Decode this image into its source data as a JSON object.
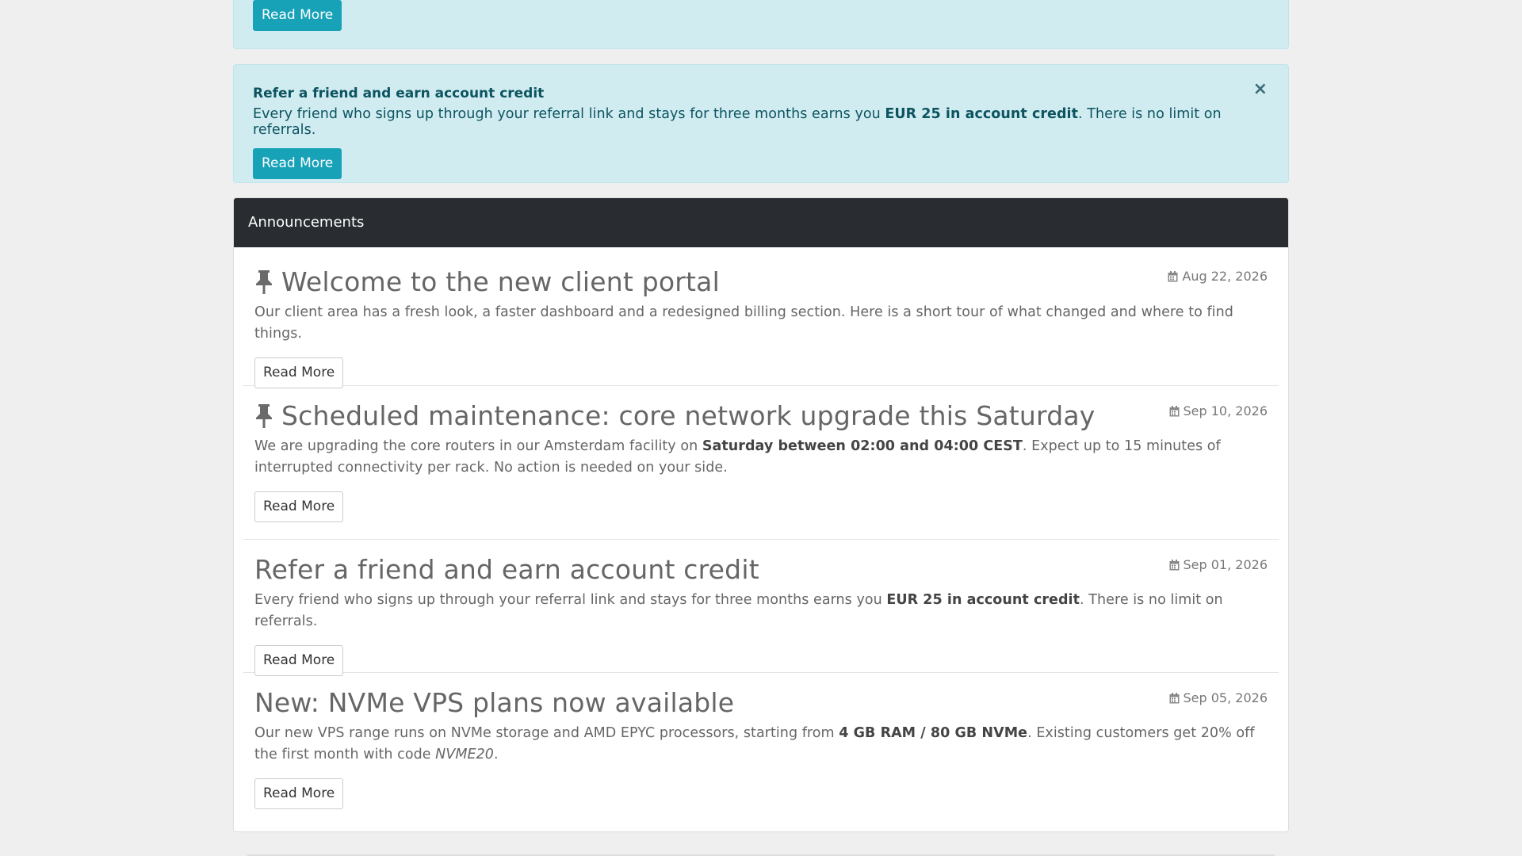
{
  "top_alert": {
    "button_label": "Read More"
  },
  "referral_alert": {
    "title": "Refer a friend and earn account credit",
    "text_before": "Every friend who signs up through your referral link and stays for three months earns you ",
    "text_bold": "EUR 25 in account credit",
    "text_after": ". There is no limit on referrals.",
    "close_glyph": "×",
    "button_label": "Read More"
  },
  "announcements": {
    "heading": "Announcements",
    "items": [
      {
        "title": "Welcome to the new client portal",
        "pinned": true,
        "date": "Aug 22, 2026",
        "body_1": "Our client area has a fresh look, a faster dashboard and a redesigned billing section. Here is a short tour of what changed and where to find things.",
        "button_label": "Read More"
      },
      {
        "title": "Scheduled maintenance: core network upgrade this Saturday",
        "pinned": true,
        "date": "Sep 10, 2026",
        "body_1": "We are upgrading the core routers in our Amsterdam facility on ",
        "body_bold": "Saturday between 02:00 and 04:00 CEST",
        "body_2": ". Expect up to 15 minutes of interrupted connectivity per rack. No action is needed on your side.",
        "button_label": "Read More"
      },
      {
        "title": "Refer a friend and earn account credit",
        "pinned": false,
        "date": "Sep 01, 2026",
        "body_1": "Every friend who signs up through your referral link and stays for three months earns you ",
        "body_bold": "EUR 25 in account credit",
        "body_2": ". There is no limit on referrals.",
        "button_label": "Read More"
      },
      {
        "title": "New: NVMe VPS plans now available",
        "pinned": false,
        "date": "Sep 05, 2026",
        "body_1": "Our new VPS range runs on NVMe storage and AMD EPYC processors, starting from ",
        "body_bold": "4 GB RAM / 80 GB NVMe",
        "body_2": ". Existing customers get 20% off the first month with code ",
        "body_italic": "NVME20",
        "body_3": ".",
        "button_label": "Read More"
      }
    ]
  },
  "icons": {
    "pin": "pin-icon",
    "calendar": "calendar-icon",
    "close": "close-icon"
  },
  "colors": {
    "accent": "#17a2b8",
    "alert_bg": "#d1ecf1",
    "alert_text": "#0c5460",
    "heading_bg": "#292d31"
  }
}
